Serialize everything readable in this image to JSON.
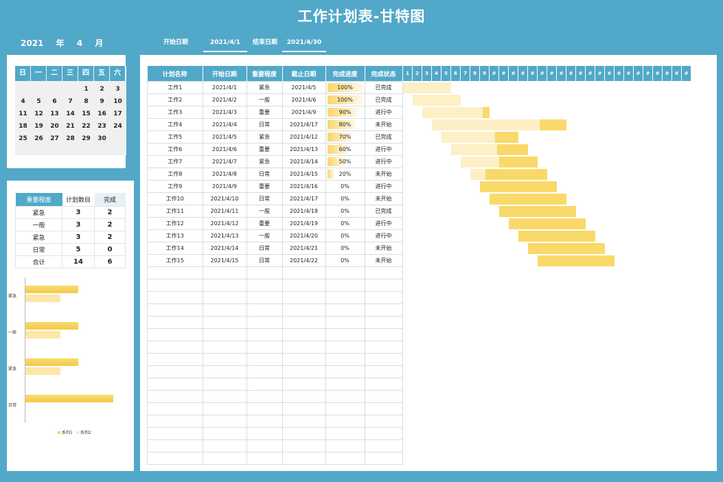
{
  "title": "工作计划表-甘特图",
  "year": "2021",
  "year_unit": "年",
  "month": "4",
  "month_unit": "月",
  "start_label": "开始日期",
  "start_value": "2021/4/1",
  "end_label": "结束日期",
  "end_value": "2021/4/30",
  "calendar": {
    "weekdays": [
      "日",
      "一",
      "二",
      "三",
      "四",
      "五",
      "六"
    ],
    "weeks": [
      [
        "",
        "",
        "",
        "",
        "1",
        "2",
        "3"
      ],
      [
        "4",
        "5",
        "6",
        "7",
        "8",
        "9",
        "10"
      ],
      [
        "11",
        "12",
        "13",
        "14",
        "15",
        "16",
        "17"
      ],
      [
        "18",
        "19",
        "20",
        "21",
        "22",
        "23",
        "24"
      ],
      [
        "25",
        "26",
        "27",
        "28",
        "29",
        "30",
        ""
      ]
    ]
  },
  "summary": {
    "headers": [
      "重要程度",
      "计划数目",
      "完成"
    ],
    "rows": [
      [
        "紧急",
        "3",
        "2"
      ],
      [
        "一般",
        "3",
        "2"
      ],
      [
        "紧急",
        "3",
        "2"
      ],
      [
        "日常",
        "5",
        "0"
      ],
      [
        "合计",
        "14",
        "6"
      ]
    ]
  },
  "main": {
    "headers": [
      "计划名称",
      "开始日期",
      "重要程度",
      "截止日期",
      "完成进度",
      "完成状态"
    ],
    "rows": [
      {
        "name": "工作1",
        "start": "2021/4/1",
        "level": "紧急",
        "end": "2021/4/5",
        "progress": "100%",
        "status": "已完成"
      },
      {
        "name": "工作2",
        "start": "2021/4/2",
        "level": "一般",
        "end": "2021/4/6",
        "progress": "100%",
        "status": "已完成"
      },
      {
        "name": "工作3",
        "start": "2021/4/3",
        "level": "重要",
        "end": "2021/4/9",
        "progress": "90%",
        "status": "进行中"
      },
      {
        "name": "工作4",
        "start": "2021/4/4",
        "level": "日常",
        "end": "2021/4/17",
        "progress": "80%",
        "status": "未开始"
      },
      {
        "name": "工作5",
        "start": "2021/4/5",
        "level": "紧急",
        "end": "2021/4/12",
        "progress": "70%",
        "status": "已完成"
      },
      {
        "name": "工作6",
        "start": "2021/4/6",
        "level": "重要",
        "end": "2021/4/13",
        "progress": "60%",
        "status": "进行中"
      },
      {
        "name": "工作7",
        "start": "2021/4/7",
        "level": "紧急",
        "end": "2021/4/14",
        "progress": "50%",
        "status": "进行中"
      },
      {
        "name": "工作8",
        "start": "2021/4/8",
        "level": "日常",
        "end": "2021/4/15",
        "progress": "20%",
        "status": "未开始"
      },
      {
        "name": "工作9",
        "start": "2021/4/9",
        "level": "重要",
        "end": "2021/4/16",
        "progress": "0%",
        "status": "进行中"
      },
      {
        "name": "工作10",
        "start": "2021/4/10",
        "level": "日常",
        "end": "2021/4/17",
        "progress": "0%",
        "status": "未开始"
      },
      {
        "name": "工作11",
        "start": "2021/4/11",
        "level": "一般",
        "end": "2021/4/18",
        "progress": "0%",
        "status": "已完成"
      },
      {
        "name": "工作12",
        "start": "2021/4/12",
        "level": "重要",
        "end": "2021/4/19",
        "progress": "0%",
        "status": "进行中"
      },
      {
        "name": "工作13",
        "start": "2021/4/13",
        "level": "一般",
        "end": "2021/4/20",
        "progress": "0%",
        "status": "进行中"
      },
      {
        "name": "工作14",
        "start": "2021/4/14",
        "level": "日常",
        "end": "2021/4/21",
        "progress": "0%",
        "status": "未开始"
      },
      {
        "name": "工作15",
        "start": "2021/4/15",
        "level": "日常",
        "end": "2021/4/22",
        "progress": "0%",
        "status": "未开始"
      }
    ]
  },
  "gantt": {
    "day_labels": [
      "1",
      "2",
      "3",
      "4",
      "5",
      "6",
      "7",
      "8",
      "9",
      "#",
      "#",
      "#",
      "#",
      "#",
      "#",
      "#",
      "#",
      "#",
      "#",
      "#",
      "#",
      "#",
      "#",
      "#",
      "#",
      "#",
      "#",
      "#",
      "#",
      "#"
    ]
  },
  "chart_data": {
    "type": "bar",
    "categories": [
      "紧急",
      "一般",
      "紧急",
      "日常"
    ],
    "series": [
      {
        "name": "系列1",
        "values": [
          3,
          3,
          3,
          5
        ]
      },
      {
        "name": "系列2",
        "values": [
          2,
          2,
          2,
          0
        ]
      }
    ],
    "colors": [
      "#f7d35f",
      "#fde6a8"
    ]
  }
}
